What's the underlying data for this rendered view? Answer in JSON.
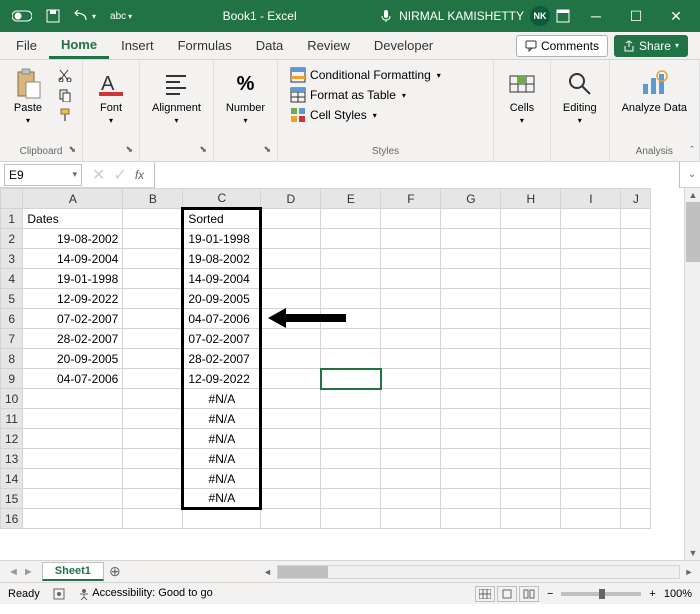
{
  "title": {
    "app": "Book1 - Excel",
    "user": "NIRMAL KAMISHETTY",
    "user_initials": "NK"
  },
  "qat": {
    "autosave_label": "abc"
  },
  "tabs": {
    "file": "File",
    "home": "Home",
    "insert": "Insert",
    "formulas": "Formulas",
    "data": "Data",
    "review": "Review",
    "developer": "Developer",
    "comments": "Comments",
    "share": "Share"
  },
  "ribbon": {
    "clipboard": {
      "paste": "Paste",
      "label": "Clipboard"
    },
    "font": {
      "btn": "Font"
    },
    "alignment": {
      "btn": "Alignment"
    },
    "number": {
      "btn": "Number",
      "percent": "%"
    },
    "styles": {
      "cond_fmt": "Conditional Formatting",
      "fmt_table": "Format as Table",
      "cell_styles": "Cell Styles",
      "label": "Styles"
    },
    "cells": {
      "btn": "Cells"
    },
    "editing": {
      "btn": "Editing"
    },
    "analysis": {
      "btn": "Analyze Data",
      "label": "Analysis"
    }
  },
  "namebox": {
    "ref": "E9",
    "fx": "fx"
  },
  "columns": [
    "A",
    "B",
    "C",
    "D",
    "E",
    "F",
    "G",
    "H",
    "I",
    "J"
  ],
  "rows": [
    {
      "n": "1",
      "a": "Dates",
      "c": "Sorted"
    },
    {
      "n": "2",
      "a": "19-08-2002",
      "c": "19-01-1998"
    },
    {
      "n": "3",
      "a": "14-09-2004",
      "c": "19-08-2002"
    },
    {
      "n": "4",
      "a": "19-01-1998",
      "c": "14-09-2004"
    },
    {
      "n": "5",
      "a": "12-09-2022",
      "c": "20-09-2005"
    },
    {
      "n": "6",
      "a": "07-02-2007",
      "c": "04-07-2006"
    },
    {
      "n": "7",
      "a": "28-02-2007",
      "c": "07-02-2007"
    },
    {
      "n": "8",
      "a": "20-09-2005",
      "c": "28-02-2007"
    },
    {
      "n": "9",
      "a": "04-07-2006",
      "c": "12-09-2022"
    },
    {
      "n": "10",
      "a": "",
      "c": "#N/A"
    },
    {
      "n": "11",
      "a": "",
      "c": "#N/A"
    },
    {
      "n": "12",
      "a": "",
      "c": "#N/A"
    },
    {
      "n": "13",
      "a": "",
      "c": "#N/A"
    },
    {
      "n": "14",
      "a": "",
      "c": "#N/A"
    },
    {
      "n": "15",
      "a": "",
      "c": "#N/A"
    },
    {
      "n": "16",
      "a": "",
      "c": ""
    }
  ],
  "sheet": {
    "name": "Sheet1"
  },
  "status": {
    "ready": "Ready",
    "accessibility": "Accessibility: Good to go",
    "zoom": "100%"
  }
}
